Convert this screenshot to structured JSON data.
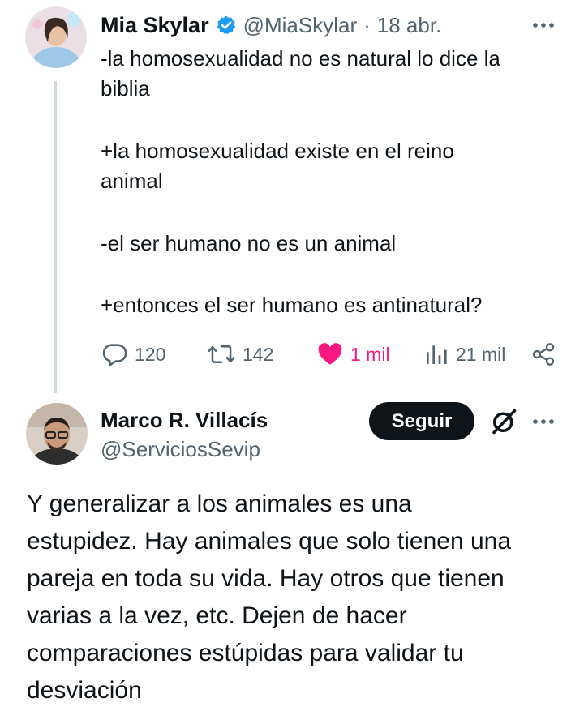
{
  "tweet": {
    "author_name": "Mia Skylar",
    "handle": "@MiaSkylar",
    "separator": "·",
    "date": "18 abr.",
    "lines": [
      "-la homosexualidad no es natural lo dice la",
      "biblia",
      "+la homosexualidad existe en el reino",
      "animal",
      "-el ser humano no es un animal",
      "+entonces el ser humano es antinatural?"
    ],
    "replies": "120",
    "reposts": "142",
    "likes": "1 mil",
    "views": "21 mil"
  },
  "reply": {
    "author_name": "Marco R. Villacís",
    "handle": "@ServiciosSevip",
    "follow_label": "Seguir",
    "lines": [
      "Y generalizar a los animales es una",
      "estupidez. Hay animales que solo tienen una",
      "pareja en toda su vida. Hay otros que tienen",
      "varias a la vez, etc. Dejen de hacer",
      "comparaciones estúpidas para validar tu",
      "desviación"
    ]
  },
  "colors": {
    "verified": "#1d9bf0",
    "like": "#f91880",
    "text": "#0f1419",
    "muted": "#536471",
    "line": "#cfd9de"
  },
  "icons": [
    "verified-badge-icon",
    "more-options-icon",
    "reply-icon",
    "repost-icon",
    "like-icon",
    "views-icon",
    "share-icon",
    "grok-icon"
  ]
}
